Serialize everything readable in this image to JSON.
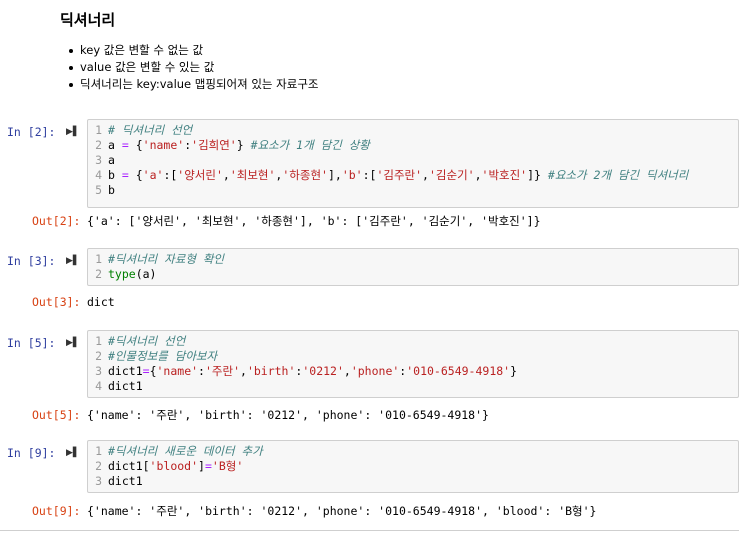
{
  "markdown": {
    "title": "딕셔너리",
    "bullets": [
      "key 값은 변할 수 없는 값",
      "value 값은 변할 수 있는 값",
      "딕셔너리는 key:value 맵핑되어져 있는 자료구조"
    ]
  },
  "cells": [
    {
      "in_prompt": "In [2]:",
      "lines": [
        {
          "n": "1",
          "parts": [
            {
              "t": "cm",
              "v": "# 딕셔너리 선언"
            }
          ]
        },
        {
          "n": "2",
          "parts": [
            {
              "t": "",
              "v": "a "
            },
            {
              "t": "op",
              "v": "="
            },
            {
              "t": "",
              "v": " {"
            },
            {
              "t": "st",
              "v": "'name'"
            },
            {
              "t": "",
              "v": ":"
            },
            {
              "t": "st",
              "v": "'김희연'"
            },
            {
              "t": "",
              "v": "} "
            },
            {
              "t": "cm",
              "v": "#요소가 1개 담긴 상황"
            }
          ]
        },
        {
          "n": "3",
          "parts": [
            {
              "t": "",
              "v": "a"
            }
          ]
        },
        {
          "n": "4",
          "parts": [
            {
              "t": "",
              "v": "b "
            },
            {
              "t": "op",
              "v": "="
            },
            {
              "t": "",
              "v": " {"
            },
            {
              "t": "st",
              "v": "'a'"
            },
            {
              "t": "",
              "v": ":["
            },
            {
              "t": "st",
              "v": "'양서린'"
            },
            {
              "t": "",
              "v": ","
            },
            {
              "t": "st",
              "v": "'최보현'"
            },
            {
              "t": "",
              "v": ","
            },
            {
              "t": "st",
              "v": "'하종현'"
            },
            {
              "t": "",
              "v": "],"
            },
            {
              "t": "st",
              "v": "'b'"
            },
            {
              "t": "",
              "v": ":["
            },
            {
              "t": "st",
              "v": "'김주란'"
            },
            {
              "t": "",
              "v": ","
            },
            {
              "t": "st",
              "v": "'김순기'"
            },
            {
              "t": "",
              "v": ","
            },
            {
              "t": "st",
              "v": "'박호진'"
            },
            {
              "t": "",
              "v": "]} "
            },
            {
              "t": "cm",
              "v": "#요소가 2개 담긴 딕셔너리"
            }
          ]
        },
        {
          "n": "5",
          "parts": [
            {
              "t": "",
              "v": "b"
            }
          ]
        }
      ],
      "out_prompt": "Out[2]:",
      "output": "{'a': ['양서린', '최보현', '하종현'], 'b': ['김주란', '김순기', '박호진']}"
    },
    {
      "in_prompt": "In [3]:",
      "lines": [
        {
          "n": "1",
          "parts": [
            {
              "t": "cm",
              "v": "#딕셔너리 자료형 확인"
            }
          ]
        },
        {
          "n": "2",
          "parts": [
            {
              "t": "bi",
              "v": "type"
            },
            {
              "t": "",
              "v": "(a)"
            }
          ]
        }
      ],
      "out_prompt": "Out[3]:",
      "output": "dict"
    },
    {
      "in_prompt": "In [5]:",
      "lines": [
        {
          "n": "1",
          "parts": [
            {
              "t": "cm",
              "v": "#딕셔너리 선언"
            }
          ]
        },
        {
          "n": "2",
          "parts": [
            {
              "t": "cm",
              "v": "#인물정보를 담아보자"
            }
          ]
        },
        {
          "n": "3",
          "parts": [
            {
              "t": "",
              "v": "dict1"
            },
            {
              "t": "op",
              "v": "="
            },
            {
              "t": "",
              "v": "{"
            },
            {
              "t": "st",
              "v": "'name'"
            },
            {
              "t": "",
              "v": ":"
            },
            {
              "t": "st",
              "v": "'주란'"
            },
            {
              "t": "",
              "v": ","
            },
            {
              "t": "st",
              "v": "'birth'"
            },
            {
              "t": "",
              "v": ":"
            },
            {
              "t": "st",
              "v": "'0212'"
            },
            {
              "t": "",
              "v": ","
            },
            {
              "t": "st",
              "v": "'phone'"
            },
            {
              "t": "",
              "v": ":"
            },
            {
              "t": "st",
              "v": "'010-6549-4918'"
            },
            {
              "t": "",
              "v": "}"
            }
          ]
        },
        {
          "n": "4",
          "parts": [
            {
              "t": "",
              "v": "dict1"
            }
          ]
        }
      ],
      "out_prompt": "Out[5]:",
      "output": "{'name': '주란', 'birth': '0212', 'phone': '010-6549-4918'}"
    },
    {
      "in_prompt": "In [9]:",
      "lines": [
        {
          "n": "1",
          "parts": [
            {
              "t": "cm",
              "v": "#딕셔너리 새로운 데이터 추가"
            }
          ]
        },
        {
          "n": "2",
          "parts": [
            {
              "t": "",
              "v": "dict1["
            },
            {
              "t": "st",
              "v": "'blood'"
            },
            {
              "t": "",
              "v": "]"
            },
            {
              "t": "op",
              "v": "="
            },
            {
              "t": "st",
              "v": "'B형'"
            }
          ]
        },
        {
          "n": "3",
          "parts": [
            {
              "t": "",
              "v": "dict1"
            }
          ]
        }
      ],
      "out_prompt": "Out[9]:",
      "output": "{'name': '주란', 'birth': '0212', 'phone': '010-6549-4918', 'blood': 'B형'}"
    }
  ],
  "icons": {
    "run": "run-cell-icon"
  },
  "colors": {
    "in_prompt": "#303f9f",
    "out_prompt": "#d84315",
    "comment": "#408080",
    "string": "#ba2121",
    "operator": "#aa22ff",
    "builtin": "#008000"
  }
}
